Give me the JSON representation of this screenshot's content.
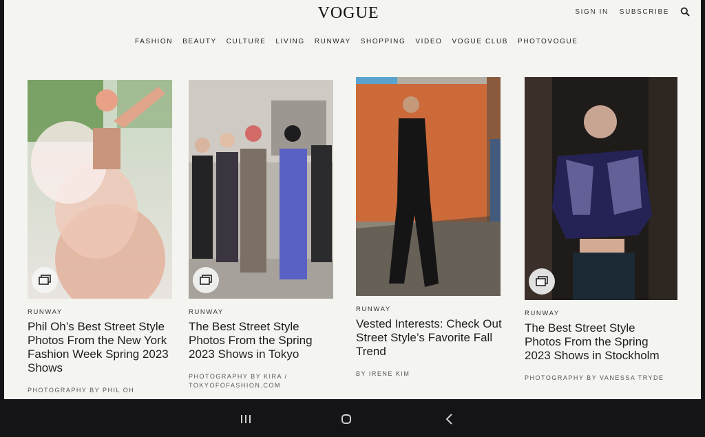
{
  "header": {
    "logo": "VOGUE",
    "sign_in": "SIGN IN",
    "subscribe": "SUBSCRIBE"
  },
  "nav": {
    "items": [
      "FASHION",
      "BEAUTY",
      "CULTURE",
      "LIVING",
      "RUNWAY",
      "SHOPPING",
      "VIDEO",
      "VOGUE CLUB",
      "PHOTOVOGUE"
    ]
  },
  "cards": [
    {
      "section": "RUNWAY",
      "headline": "Phil Oh’s Best Street Style Photos From the New York Fashion Week Spring 2023 Shows",
      "byline": "PHOTOGRAPHY BY PHIL OH",
      "has_gallery_icon": true
    },
    {
      "section": "RUNWAY",
      "headline": "The Best Street Style Photos From the Spring 2023 Shows in Tokyo",
      "byline": "PHOTOGRAPHY BY KIRA / TOKYOFOFASHION.COM",
      "has_gallery_icon": true
    },
    {
      "section": "RUNWAY",
      "headline": "Vested Interests: Check Out Street Style’s Favorite Fall Trend",
      "byline": "BY IRENE KIM",
      "has_gallery_icon": false
    },
    {
      "section": "RUNWAY",
      "headline": "The Best Street Style Photos From the Spring 2023 Shows in Stockholm",
      "byline": "PHOTOGRAPHY BY VANESSA TRYDE",
      "has_gallery_icon": true
    }
  ],
  "icons": {
    "search": "search-icon",
    "gallery": "gallery-icon",
    "recents": "recents-icon",
    "home": "home-icon",
    "back": "back-icon"
  },
  "colors": {
    "page_bg": "#f4f4f1",
    "text": "#1e1e1e",
    "device_bezel": "#141416"
  }
}
